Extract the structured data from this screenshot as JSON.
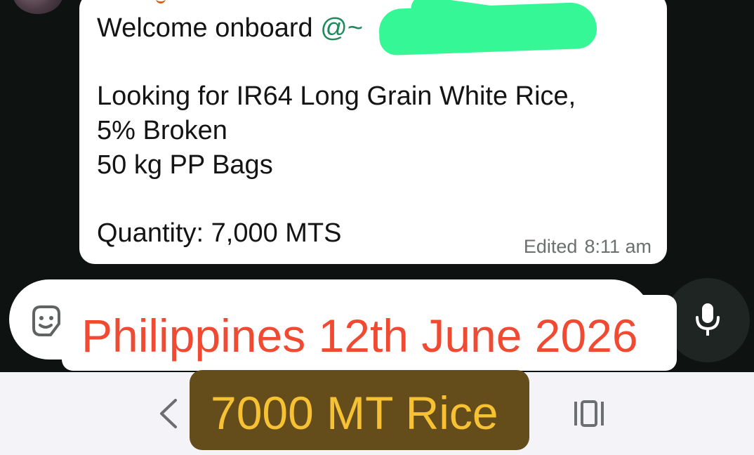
{
  "message": {
    "greeting": "Welcome onboard",
    "mention_prefix": "@~",
    "line_product": "Looking for IR64 Long Grain White Rice,",
    "line_broken": "5% Broken",
    "line_bags": "50 kg PP Bags",
    "line_quantity": "Quantity: 7,000 MTS",
    "edited_label": "Edited",
    "time": "8:11 am"
  },
  "overlay_captions": {
    "top": "Philippines 12th June 2026",
    "bottom": "7000 MT Rice"
  },
  "colors": {
    "bubble": "#ffffff",
    "mention": "#1f8a5b",
    "redaction": "#35f795",
    "caption_top_text": "#f04a33",
    "caption_bottom_bg": "#654d1b",
    "caption_bottom_text": "#f7c134"
  },
  "icons": {
    "composer_sticker": "sticker-emoji-icon",
    "send_voice": "microphone-icon",
    "nav_back": "chevron-left-icon",
    "nav_recents": "recent-apps-icon"
  }
}
